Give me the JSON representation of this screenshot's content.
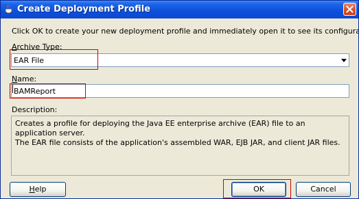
{
  "window": {
    "title": "Create Deployment Profile",
    "close_label": "Close"
  },
  "intro_text": "Click OK to create your new deployment profile and immediately open it to see its configuration.",
  "archive_type": {
    "label_mnemonic": "A",
    "label_rest": "rchive Type:",
    "selected": "EAR File"
  },
  "name_field": {
    "label_mnemonic": "N",
    "label_rest": "ame:",
    "value": "BAMReport"
  },
  "description": {
    "label": "Description:",
    "line1": "Creates a profile for deploying the Java EE enterprise archive (EAR) file to an application server.",
    "line2": "The EAR file consists of the application's assembled WAR, EJB JAR, and client JAR files."
  },
  "buttons": {
    "help_mnemonic": "H",
    "help_rest": "elp",
    "ok": "OK",
    "cancel": "Cancel"
  },
  "colors": {
    "titlebar": "#0d4fdc",
    "highlight": "#d00000",
    "dialog_bg": "#ece9d8"
  }
}
